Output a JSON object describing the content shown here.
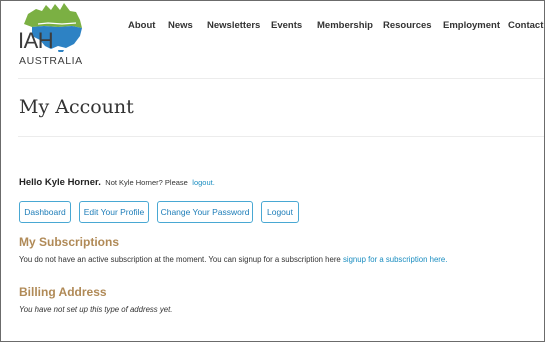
{
  "logo": {
    "name": "IAH",
    "subname": "AUSTRALIA",
    "colors": {
      "green": "#7bb043",
      "blue": "#2d82c4",
      "dark": "#3c3c3c"
    }
  },
  "nav": {
    "items": [
      "About",
      "News",
      "Newsletters",
      "Events",
      "Membership",
      "Resources",
      "Employment",
      "Contact"
    ]
  },
  "page": {
    "title": "My Account"
  },
  "greeting": {
    "hello": "Hello Kyle Horner.",
    "not_user": "Not Kyle Horner? Please",
    "logout_link": "logout."
  },
  "buttons": {
    "dashboard": "Dashboard",
    "edit_profile": "Edit Your Profile",
    "change_password": "Change Your Password",
    "logout": "Logout"
  },
  "subscriptions": {
    "heading": "My Subscriptions",
    "text": "You do not have an active subscription at the moment. You can signup for a subscription here",
    "link": "signup for a subscription here."
  },
  "billing": {
    "heading": "Billing Address",
    "text": "You have not set up this type of address yet."
  },
  "colors": {
    "accent_link": "#1a8dc0",
    "section_heading": "#b08a57",
    "button_border": "#49a8d3"
  }
}
